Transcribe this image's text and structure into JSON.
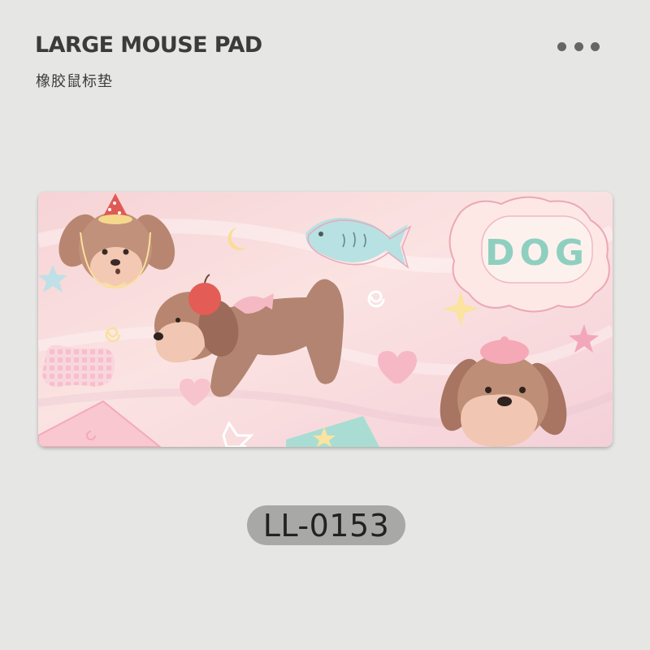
{
  "header": {
    "title": "LARGE MOUSE PAD",
    "subtitle": "橡胶鼠标垫"
  },
  "more_icon": "more-horizontal-icon",
  "product": {
    "image_text": "DOG",
    "colors": {
      "pad_background": "#f7d8dc",
      "dog_brown": "#b88670",
      "text_mint": "#8fcfc0"
    }
  },
  "sku": "LL-0153"
}
